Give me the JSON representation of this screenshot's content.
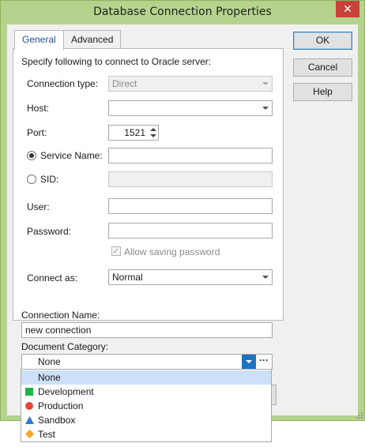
{
  "window": {
    "title": "Database Connection Properties",
    "close_glyph": "✕"
  },
  "tabs": [
    {
      "label": "General",
      "active": true
    },
    {
      "label": "Advanced",
      "active": false
    }
  ],
  "general": {
    "instruction": "Specify following to connect to Oracle server:",
    "connection_type": {
      "label": "Connection type:",
      "value": "Direct",
      "disabled": true
    },
    "host": {
      "label": "Host:",
      "value": ""
    },
    "port": {
      "label": "Port:",
      "value": "1521"
    },
    "service_name": {
      "label": "Service Name:",
      "value": "",
      "selected": true
    },
    "sid": {
      "label": "SID:",
      "value": "",
      "selected": false,
      "disabled": true
    },
    "user": {
      "label": "User:",
      "value": ""
    },
    "password": {
      "label": "Password:",
      "value": ""
    },
    "allow_saving_password": {
      "label": "Allow saving password",
      "checked": true,
      "disabled": true
    },
    "connect_as": {
      "label": "Connect as:",
      "value": "Normal"
    }
  },
  "connection_name": {
    "label": "Connection Name:",
    "value": "new connection"
  },
  "document_category": {
    "label": "Document Category:",
    "value": "None",
    "ellipsis": "···",
    "options": [
      {
        "label": "None",
        "icon": "none",
        "color": "",
        "selected": true
      },
      {
        "label": "Development",
        "icon": "square-icon",
        "color": "#22b14c",
        "selected": false
      },
      {
        "label": "Production",
        "icon": "circle-icon",
        "color": "#e8463a",
        "selected": false
      },
      {
        "label": "Sandbox",
        "icon": "triangle-icon",
        "color": "#2a7ad6",
        "selected": false
      },
      {
        "label": "Test",
        "icon": "diamond-icon",
        "color": "#f5a623",
        "selected": false
      }
    ]
  },
  "buttons": {
    "ok": "OK",
    "cancel": "Cancel",
    "help": "Help"
  },
  "colors": {
    "frame": "#b5d38c",
    "close": "#c7433a",
    "accent": "#1e73be",
    "selection": "#cce0f7"
  }
}
